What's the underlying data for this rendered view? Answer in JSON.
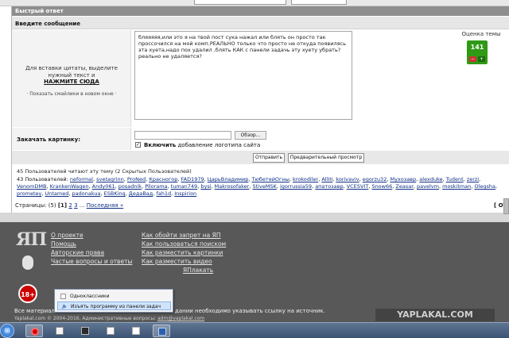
{
  "quick_reply": {
    "title": "Быстрый ответ",
    "subtitle": "Введите сообщение",
    "quote_hint": "Для вставки цитаты, выделите нужный текст и",
    "quote_action": "НАЖМИТЕ СЮДА",
    "smilies_link": "· Показать смайлики в новом окне ·",
    "message": "бляяяяя,или это я на твой пост сука нажал или блять он просто так проссочился на мой комп.РЕАЛЬНО только что просто не откуда появилясь эта хуета,надо пох удалил ,блять КАК с панели задачь эту хуету убрать? реально не удаляется?",
    "rating_label": "Оценка темы",
    "rating_value": "141",
    "rating_minus": "−",
    "rating_plus": "+",
    "upload_label": "Закачать картинку:",
    "browse_label": "Обзор...",
    "logo_checkbox_checked": true,
    "logo_check_mark": "✓",
    "logo_label_bold": "Включить",
    "logo_label_rest": "добавление логотипа сайта",
    "send_button": "Отправить",
    "preview_button": "Предварительный просмотр"
  },
  "readers": {
    "summary": "45 Пользователей читают эту тему (2 Скрытых Пользователей)",
    "prefix": "43 Пользователей:",
    "users": [
      "neformal",
      "svetagrinn",
      "ProNed",
      "Красногор",
      "FAD1979",
      "ЦарьВладимир",
      "ТюбетейОгны",
      "krokodiler",
      "AllIII",
      "korivaviv",
      "egorzu32",
      "Мухозавр",
      "alexduke",
      "Tudent",
      "zerzi",
      "VenomDMB",
      "KrankenWagen",
      "Andy061",
      "posadnik",
      "Pilorama",
      "tuman749",
      "bysi",
      "Makrosofaker",
      "StiveMSK",
      "igorrussia59",
      "апатозавр",
      "VCESVIT",
      "Snow66",
      "Zeasar",
      "pavelvm",
      "moskitman",
      "Olegsha",
      "prometey",
      "Untamed",
      "padonakua",
      "ESBKing",
      "ДедаВад",
      "fah1d",
      "Inspirion"
    ]
  },
  "pagination": {
    "prefix": "Страницы: (5)",
    "current": "[1]",
    "p2": "2",
    "p3": "3",
    "ellipsis": "...",
    "last": "Последняя »",
    "right_label": "[ ОТВЕТИТЬ"
  },
  "footer": {
    "logo": "ЯП",
    "age_badge": "18+",
    "col1": [
      "О проекте",
      "Помощь",
      "Авторские права",
      "Частые вопросы и ответы"
    ],
    "col2": [
      "Как обойти запрет на ЯП",
      "Как пользоваться поиском",
      "Как разместить картинки",
      "Как разместить видео"
    ],
    "col2_partial": "ЯПлакать",
    "notice_start": "Все материал",
    "notice_end": "дании необходимо указывать ссылку на источник.",
    "copyright_start": "Yaplakal.com © 2004-2016. Административные вопросы: ",
    "copyright_email": "adm@yaplakal.com"
  },
  "watermark": "YAPLAKAL.COM",
  "jump_list": {
    "items": [
      "Одноклассники",
      "Изъять программу из панели задач"
    ]
  },
  "taskbar": {
    "start_icon": "windows-orb-icon",
    "start_glyph": "⊞",
    "pinned": [
      "opera-icon",
      "document-icon",
      "movie-icon",
      "file-icon",
      "blank-file-icon",
      "word-icon"
    ]
  },
  "colors": {
    "rating_green": "#2f9a16",
    "footer_bg": "#585858",
    "link_blue": "#0f2f86",
    "taskbar": "#4a6283"
  }
}
